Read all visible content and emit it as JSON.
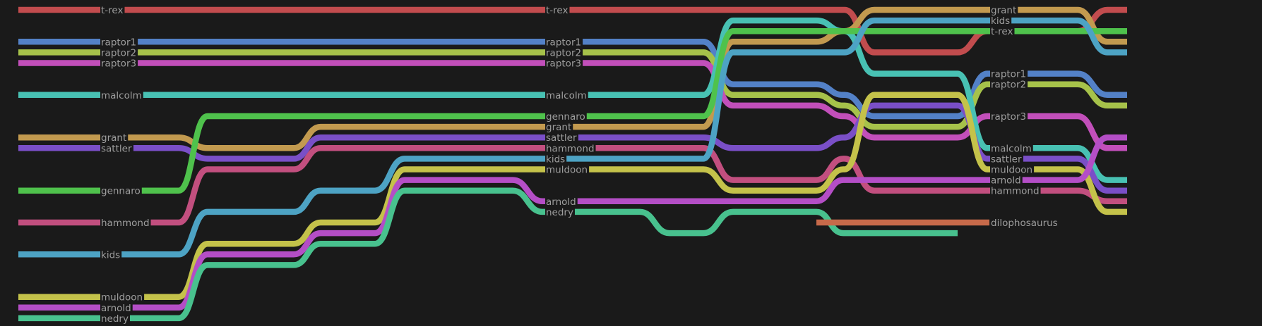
{
  "diagram": {
    "type": "storyline",
    "characters": [
      {
        "id": "t-rex",
        "name": "t-rex",
        "color": "#c24c4e"
      },
      {
        "id": "raptor1",
        "name": "raptor1",
        "color": "#5381c7"
      },
      {
        "id": "raptor2",
        "name": "raptor2",
        "color": "#a6c24a"
      },
      {
        "id": "raptor3",
        "name": "raptor3",
        "color": "#c24fba"
      },
      {
        "id": "malcolm",
        "name": "malcolm",
        "color": "#48c1b3"
      },
      {
        "id": "grant",
        "name": "grant",
        "color": "#c29a4f"
      },
      {
        "id": "sattler",
        "name": "sattler",
        "color": "#7a4fc7"
      },
      {
        "id": "gennaro",
        "name": "gennaro",
        "color": "#4fc24c"
      },
      {
        "id": "hammond",
        "name": "hammond",
        "color": "#c24f7f"
      },
      {
        "id": "kids",
        "name": "kids",
        "color": "#4da3c4"
      },
      {
        "id": "muldoon",
        "name": "muldoon",
        "color": "#c4c24a"
      },
      {
        "id": "arnold",
        "name": "arnold",
        "color": "#b44ec6"
      },
      {
        "id": "nedry",
        "name": "nedry",
        "color": "#48c18e"
      },
      {
        "id": "dilophosaurus",
        "name": "dilophosaurus",
        "color": "#c76a4a"
      }
    ],
    "columns": [
      0,
      115,
      161,
      183,
      227,
      270,
      340,
      390,
      430,
      470,
      505,
      590,
      660,
      700,
      745,
      790,
      830,
      880,
      925,
      970,
      1020,
      1070,
      1130,
      1170,
      1215,
      1250,
      1290,
      1330,
      1375,
      1420,
      1470,
      1500,
      1570
    ],
    "lanes": {
      "t-rex": [
        0,
        0,
        0,
        0,
        0,
        0,
        0,
        0,
        0,
        0,
        0,
        0,
        0,
        0,
        0,
        0,
        0,
        0,
        0,
        0,
        0,
        0,
        0,
        4,
        4,
        4,
        4,
        2,
        2,
        2,
        2,
        0
      ],
      "raptor1": [
        3,
        3,
        3,
        3,
        3,
        3,
        3,
        3,
        3,
        3,
        3,
        3,
        3,
        3,
        3,
        3,
        3,
        3,
        3,
        7,
        7,
        7,
        8,
        10,
        10,
        10,
        10,
        6,
        6,
        6,
        6,
        8
      ],
      "raptor2": [
        4,
        4,
        4,
        4,
        4,
        4,
        4,
        4,
        4,
        4,
        4,
        4,
        4,
        4,
        4,
        4,
        4,
        4,
        4,
        8,
        8,
        8,
        9,
        11,
        11,
        11,
        11,
        7,
        7,
        7,
        7,
        9
      ],
      "raptor3": [
        5,
        5,
        5,
        5,
        5,
        5,
        5,
        5,
        5,
        5,
        5,
        5,
        5,
        5,
        5,
        5,
        5,
        5,
        5,
        9,
        9,
        9,
        10,
        12,
        12,
        12,
        12,
        10,
        10,
        10,
        10,
        13
      ],
      "malcolm": [
        8,
        8,
        8,
        8,
        8,
        8,
        8,
        8,
        8,
        8,
        8,
        8,
        8,
        8,
        8,
        8,
        8,
        8,
        8,
        1,
        1,
        1,
        2,
        6,
        6,
        6,
        6,
        13,
        13,
        13,
        13,
        16
      ],
      "grant": [
        12,
        12,
        12,
        12,
        13,
        13,
        13,
        11,
        11,
        11,
        11,
        11,
        11,
        11,
        11,
        11,
        11,
        11,
        11,
        3,
        3,
        3,
        2,
        0,
        0,
        0,
        0,
        0,
        0,
        0,
        0,
        3
      ],
      "sattler": [
        13,
        13,
        13,
        13,
        14,
        14,
        14,
        12,
        12,
        12,
        12,
        12,
        12,
        12,
        12,
        12,
        12,
        12,
        12,
        13,
        13,
        13,
        12,
        9,
        9,
        9,
        9,
        14,
        14,
        14,
        14,
        17
      ],
      "gennaro": [
        17,
        17,
        17,
        17,
        10,
        10,
        10,
        10,
        10,
        10,
        10,
        10,
        10,
        10,
        10,
        10,
        10,
        10,
        10,
        2,
        2,
        2,
        2,
        2,
        2,
        2,
        2,
        2,
        2,
        2,
        2,
        2
      ],
      "hammond": [
        20,
        20,
        20,
        20,
        15,
        15,
        15,
        13,
        13,
        13,
        13,
        13,
        13,
        13,
        13,
        13,
        13,
        13,
        13,
        16,
        16,
        16,
        14,
        17,
        17,
        17,
        17,
        17,
        17,
        17,
        17,
        18
      ],
      "kids": [
        23,
        23,
        23,
        23,
        19,
        19,
        19,
        17,
        17,
        17,
        14,
        14,
        14,
        14,
        14,
        14,
        14,
        14,
        14,
        4,
        4,
        4,
        4,
        1,
        1,
        1,
        1,
        1,
        1,
        1,
        1,
        4
      ],
      "muldoon": [
        27,
        27,
        27,
        27,
        22,
        22,
        22,
        20,
        20,
        20,
        15,
        15,
        15,
        15,
        15,
        15,
        15,
        15,
        15,
        17,
        17,
        17,
        15,
        8,
        8,
        8,
        8,
        15,
        15,
        15,
        15,
        19
      ],
      "arnold": [
        28,
        28,
        28,
        28,
        23,
        23,
        23,
        21,
        21,
        21,
        16,
        16,
        16,
        18,
        18,
        18,
        18,
        18,
        18,
        18,
        18,
        18,
        16,
        16,
        16,
        16,
        16,
        16,
        16,
        16,
        16,
        12
      ],
      "nedry": [
        29,
        29,
        29,
        29,
        24,
        24,
        24,
        22,
        22,
        22,
        17,
        17,
        17,
        19,
        19,
        19,
        19,
        21,
        21,
        19,
        19,
        19,
        21,
        21,
        21,
        21,
        21,
        21,
        21,
        21,
        21,
        21
      ]
    },
    "nedry_end_col": 27,
    "dilophosaurus_span": [
      22,
      28
    ],
    "dilophosaurus_lane": 20,
    "label_points": [
      {
        "col": 1,
        "names": [
          "t-rex",
          "raptor1",
          "raptor2",
          "raptor3",
          "malcolm",
          "grant",
          "sattler",
          "gennaro",
          "hammond",
          "kids",
          "muldoon",
          "arnold",
          "nedry"
        ]
      },
      {
        "col": 14,
        "names": [
          "t-rex",
          "raptor1",
          "raptor2",
          "raptor3",
          "malcolm",
          "gennaro",
          "grant",
          "sattler",
          "hammond",
          "kids",
          "muldoon",
          "arnold",
          "nedry"
        ]
      },
      {
        "col": 28,
        "names": [
          "grant",
          "kids",
          "t-rex",
          "raptor1",
          "raptor2",
          "raptor3",
          "malcolm",
          "sattler",
          "muldoon",
          "arnold",
          "hammond",
          "dilophosaurus"
        ]
      }
    ]
  }
}
